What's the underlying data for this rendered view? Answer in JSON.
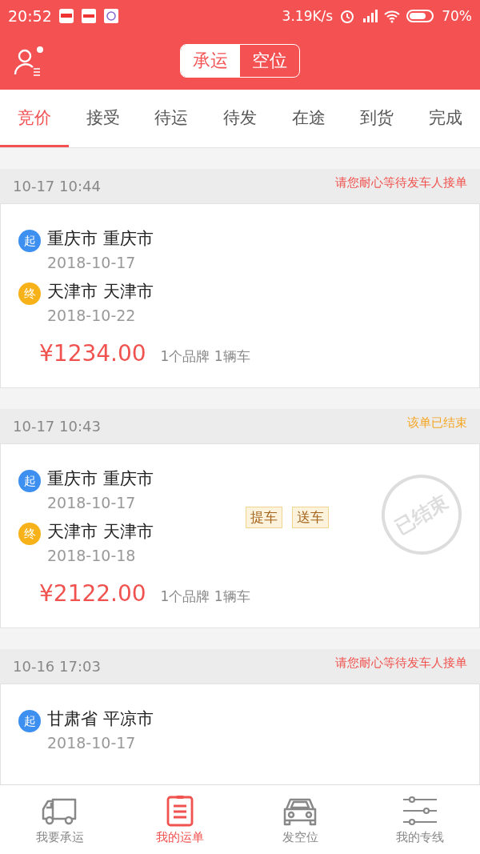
{
  "status_bar": {
    "time": "20:52",
    "speed": "3.19K/s",
    "battery": "70%"
  },
  "header": {
    "segments": [
      {
        "label": "承运",
        "selected": true
      },
      {
        "label": "空位",
        "selected": false
      }
    ]
  },
  "tabs": [
    {
      "label": "竞价",
      "selected": true
    },
    {
      "label": "接受",
      "selected": false
    },
    {
      "label": "待运",
      "selected": false
    },
    {
      "label": "待发",
      "selected": false
    },
    {
      "label": "在途",
      "selected": false
    },
    {
      "label": "到货",
      "selected": false
    },
    {
      "label": "完成",
      "selected": false
    }
  ],
  "orders": [
    {
      "time": "10-17 10:44",
      "status": {
        "text": "请您耐心等待发车人接单",
        "color": "#f0534f"
      },
      "from": {
        "badge": "起",
        "place": "重庆市 重庆市",
        "date": "2018-10-17"
      },
      "to": {
        "badge": "终",
        "place": "天津市 天津市",
        "date": "2018-10-22"
      },
      "price": "¥1234.00",
      "summary": "1个品牌  1辆车"
    },
    {
      "time": "10-17 10:43",
      "status": {
        "text": "该单已结束",
        "color": "#f5a623"
      },
      "from": {
        "badge": "起",
        "place": "重庆市 重庆市",
        "date": "2018-10-17"
      },
      "to": {
        "badge": "终",
        "place": "天津市 天津市",
        "date": "2018-10-18"
      },
      "tags": [
        "提车",
        "送车"
      ],
      "stamp": "已结束",
      "price": "¥2122.00",
      "summary": "1个品牌  1辆车"
    },
    {
      "time": "10-16 17:03",
      "status": {
        "text": "请您耐心等待发车人接单",
        "color": "#f0534f"
      },
      "from": {
        "badge": "起",
        "place": "甘肃省 平凉市",
        "date": "2018-10-17"
      }
    }
  ],
  "bottom_nav": [
    {
      "label": "我要承运",
      "kind": "truck",
      "selected": false
    },
    {
      "label": "我的运单",
      "kind": "clipboard",
      "selected": true
    },
    {
      "label": "发空位",
      "kind": "car",
      "selected": false
    },
    {
      "label": "我的专线",
      "kind": "sliders",
      "selected": false
    }
  ]
}
